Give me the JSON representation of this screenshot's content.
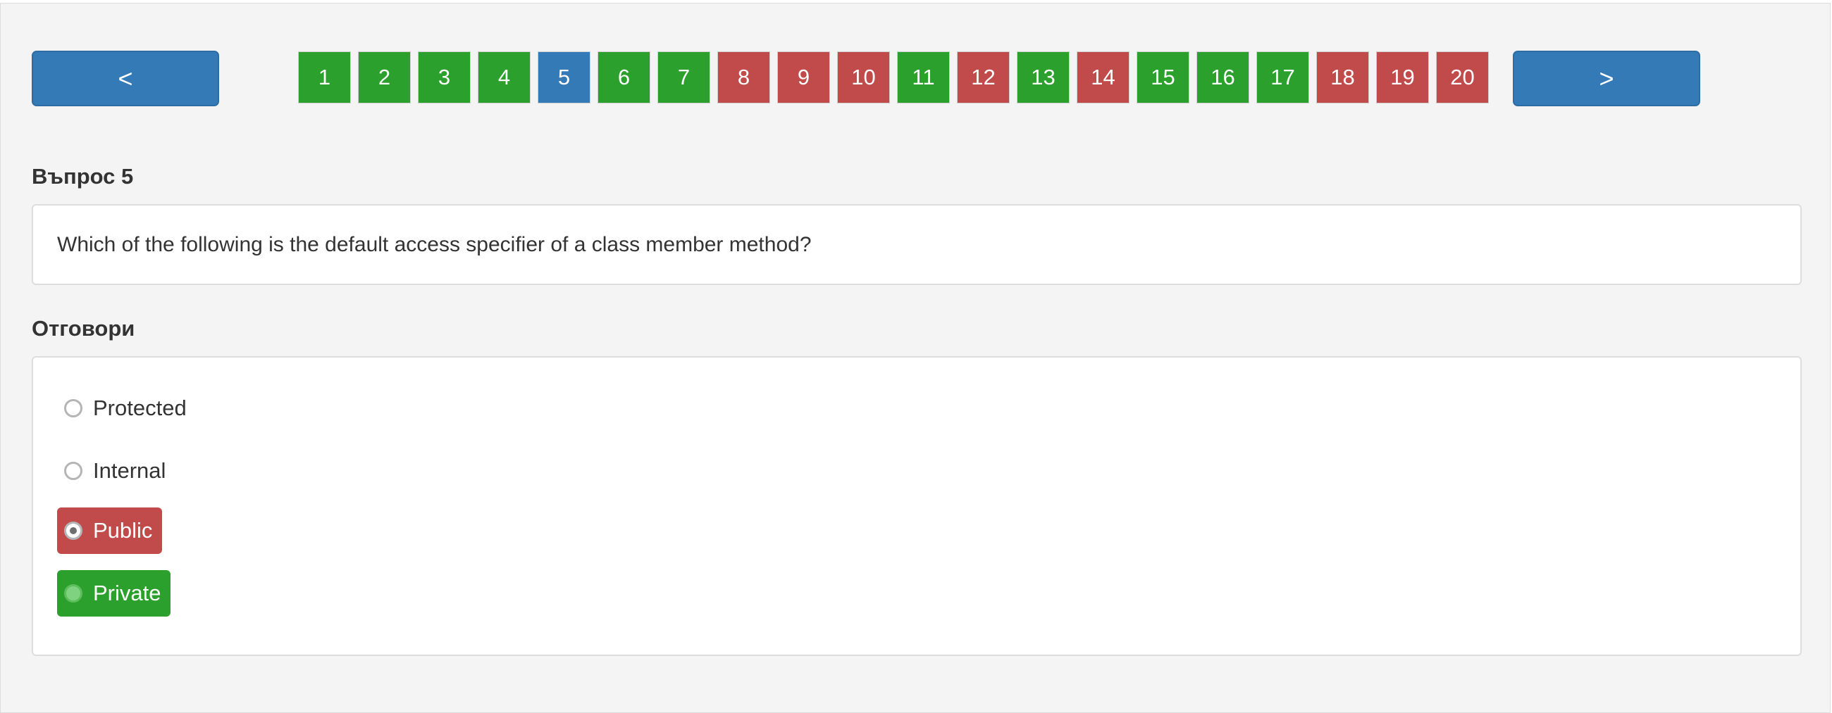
{
  "navigation": {
    "prev_label": "<",
    "next_label": ">"
  },
  "pages": [
    {
      "label": "1",
      "status": "correct"
    },
    {
      "label": "2",
      "status": "correct"
    },
    {
      "label": "3",
      "status": "correct"
    },
    {
      "label": "4",
      "status": "correct"
    },
    {
      "label": "5",
      "status": "current"
    },
    {
      "label": "6",
      "status": "correct"
    },
    {
      "label": "7",
      "status": "correct"
    },
    {
      "label": "8",
      "status": "wrong"
    },
    {
      "label": "9",
      "status": "wrong"
    },
    {
      "label": "10",
      "status": "wrong"
    },
    {
      "label": "11",
      "status": "correct"
    },
    {
      "label": "12",
      "status": "wrong"
    },
    {
      "label": "13",
      "status": "correct"
    },
    {
      "label": "14",
      "status": "wrong"
    },
    {
      "label": "15",
      "status": "correct"
    },
    {
      "label": "16",
      "status": "correct"
    },
    {
      "label": "17",
      "status": "correct"
    },
    {
      "label": "18",
      "status": "wrong"
    },
    {
      "label": "19",
      "status": "wrong"
    },
    {
      "label": "20",
      "status": "wrong"
    }
  ],
  "question": {
    "heading": "Въпрос 5",
    "text": "Which of the following is the default access specifier of a class member method?"
  },
  "answers": {
    "heading": "Отговори",
    "options": [
      {
        "label": "Protected",
        "state": "unselected"
      },
      {
        "label": "Internal",
        "state": "unselected"
      },
      {
        "label": "Public",
        "state": "selected-wrong"
      },
      {
        "label": "Private",
        "state": "correct"
      }
    ]
  },
  "colors": {
    "primary": "#337ab7",
    "correct": "#2ca02c",
    "wrong": "#c14b4b",
    "panel_background": "#f4f4f4"
  }
}
